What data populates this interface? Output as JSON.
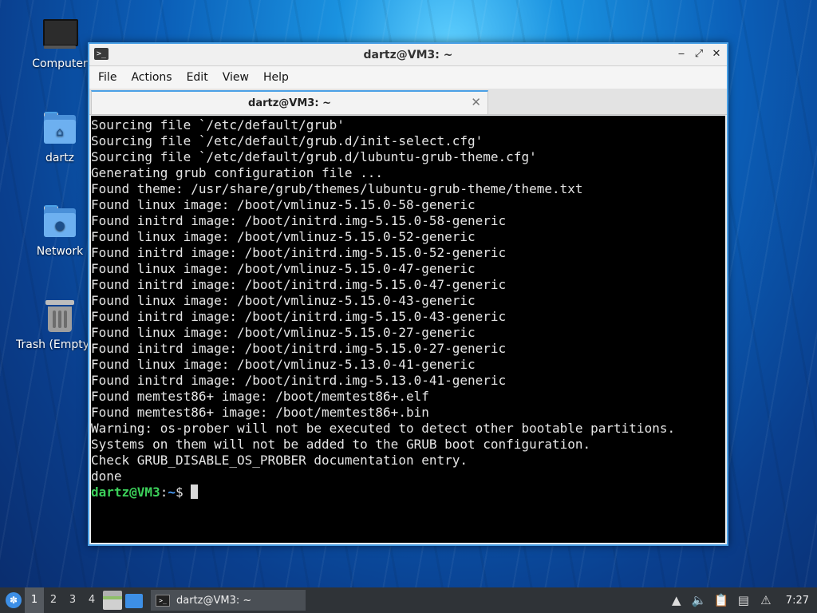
{
  "desktop": {
    "icons": [
      {
        "label": "Computer",
        "icon": "computer-icon"
      },
      {
        "label": "dartz",
        "icon": "home-folder-icon"
      },
      {
        "label": "Network",
        "icon": "network-folder-icon"
      },
      {
        "label": "Trash (Empty)",
        "icon": "trash-icon"
      }
    ]
  },
  "window": {
    "title": "dartz@VM3: ~",
    "controls": {
      "minimize": "‒",
      "maximize": "⤢",
      "close": "✕"
    },
    "menu": [
      "File",
      "Actions",
      "Edit",
      "View",
      "Help"
    ],
    "tab": {
      "title": "dartz@VM3: ~",
      "close": "✕"
    },
    "terminal": {
      "lines": [
        "Sourcing file `/etc/default/grub'",
        "Sourcing file `/etc/default/grub.d/init-select.cfg'",
        "Sourcing file `/etc/default/grub.d/lubuntu-grub-theme.cfg'",
        "Generating grub configuration file ...",
        "Found theme: /usr/share/grub/themes/lubuntu-grub-theme/theme.txt",
        "Found linux image: /boot/vmlinuz-5.15.0-58-generic",
        "Found initrd image: /boot/initrd.img-5.15.0-58-generic",
        "Found linux image: /boot/vmlinuz-5.15.0-52-generic",
        "Found initrd image: /boot/initrd.img-5.15.0-52-generic",
        "Found linux image: /boot/vmlinuz-5.15.0-47-generic",
        "Found initrd image: /boot/initrd.img-5.15.0-47-generic",
        "Found linux image: /boot/vmlinuz-5.15.0-43-generic",
        "Found initrd image: /boot/initrd.img-5.15.0-43-generic",
        "Found linux image: /boot/vmlinuz-5.15.0-27-generic",
        "Found initrd image: /boot/initrd.img-5.15.0-27-generic",
        "Found linux image: /boot/vmlinuz-5.13.0-41-generic",
        "Found initrd image: /boot/initrd.img-5.13.0-41-generic",
        "Found memtest86+ image: /boot/memtest86+.elf",
        "Found memtest86+ image: /boot/memtest86+.bin",
        "Warning: os-prober will not be executed to detect other bootable partitions.",
        "Systems on them will not be added to the GRUB boot configuration.",
        "Check GRUB_DISABLE_OS_PROBER documentation entry.",
        "done"
      ],
      "prompt": {
        "user": "dartz@VM3",
        "sep": ":",
        "path": "~",
        "symbol": "$ "
      }
    }
  },
  "taskbar": {
    "workspaces": [
      "1",
      "2",
      "3",
      "4"
    ],
    "active_workspace": "1",
    "task_label": "dartz@VM3: ~",
    "clock": "7:27",
    "tray_icons": [
      "update-notifier-icon",
      "volume-icon",
      "clipboard-icon",
      "network-icon",
      "notification-icon"
    ]
  },
  "colors": {
    "window_border": "#4aa0e6",
    "prompt_user": "#3cd05a",
    "prompt_path": "#4aa0ff",
    "taskbar_bg": "#2f3337"
  }
}
